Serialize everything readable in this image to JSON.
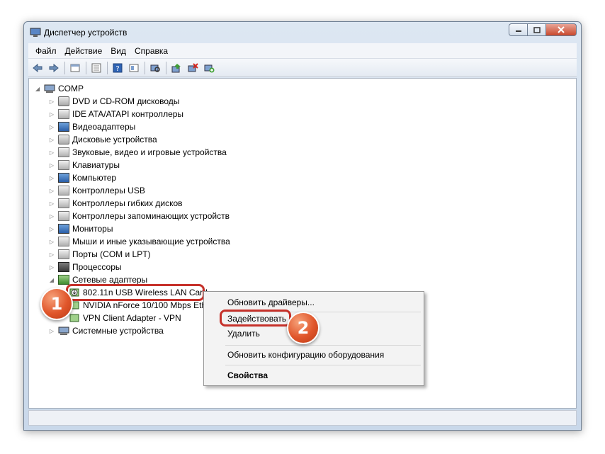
{
  "window": {
    "title": "Диспетчер устройств"
  },
  "menu": {
    "items": [
      "Файл",
      "Действие",
      "Вид",
      "Справка"
    ]
  },
  "toolbar": {
    "buttons": [
      "back-icon",
      "forward-icon",
      "sep",
      "properties-icon",
      "sep",
      "show-hidden-icon",
      "sep",
      "help-icon",
      "view-icon",
      "sep",
      "scan-hardware-icon",
      "sep",
      "update-driver-icon",
      "uninstall-icon",
      "enable-device-icon"
    ]
  },
  "tree": {
    "root": "COMP",
    "items": [
      "DVD и CD-ROM дисководы",
      "IDE ATA/ATAPI контроллеры",
      "Видеоадаптеры",
      "Дисковые устройства",
      "Звуковые, видео и игровые устройства",
      "Клавиатуры",
      "Компьютер",
      "Контроллеры USB",
      "Контроллеры гибких дисков",
      "Контроллеры запоминающих устройств",
      "Мониторы",
      "Мыши и иные указывающие устройства",
      "Порты (COM и LPT)",
      "Процессоры",
      "Сетевые адаптеры"
    ],
    "network_children": [
      "802.11n USB Wireless LAN Card",
      "NVIDIA nForce 10/100 Mbps Eth",
      "VPN Client Adapter - VPN"
    ],
    "last_item": "Системные устройства"
  },
  "context_menu": {
    "update_driver": "Обновить драйверы...",
    "enable": "Задействовать",
    "delete": "Удалить",
    "scan": "Обновить конфигурацию оборудования",
    "properties": "Свойства"
  },
  "badges": {
    "one": "1",
    "two": "2"
  },
  "colors": {
    "highlight": "#c6312a",
    "badge": "#e0552a"
  }
}
